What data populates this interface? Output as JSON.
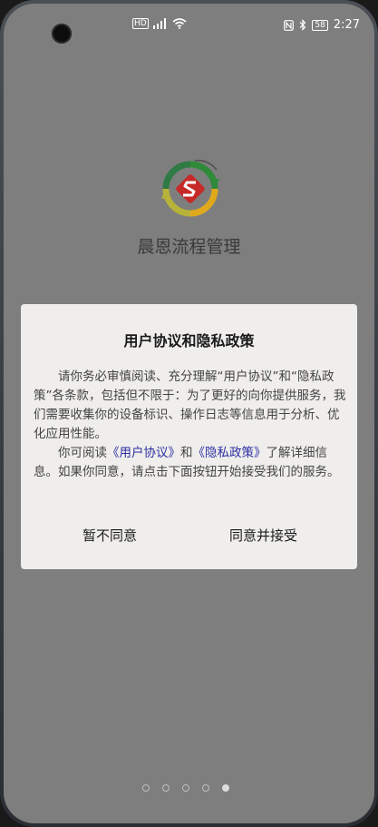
{
  "status_bar": {
    "network_badge": "HD",
    "battery_level": "58",
    "time": "2:27"
  },
  "app": {
    "name": "晨恩流程管理"
  },
  "dialog": {
    "title": "用户协议和隐私政策",
    "para1": "请你务必审慎阅读、充分理解“用户协议”和“隐私政策”各条款，包括但不限于：为了更好的向你提供服务，我们需要收集你的设备标识、操作日志等信息用于分析、优化应用性能。",
    "para2_prefix": "你可阅读",
    "link_user_agreement": "《用户协议》",
    "para2_and": "和",
    "link_privacy_policy": "《隐私政策》",
    "para2_suffix": "了解详细信息。如果你同意，请点击下面按钮开始接受我们的服务。",
    "disagree_label": "暂不同意",
    "agree_label": "同意并接受"
  },
  "pager": {
    "count": 5,
    "active_index": 4
  },
  "colors": {
    "link": "#2d2ea3",
    "dialog_bg": "#efeeec",
    "overlay_bg": "#7e7e7e"
  }
}
